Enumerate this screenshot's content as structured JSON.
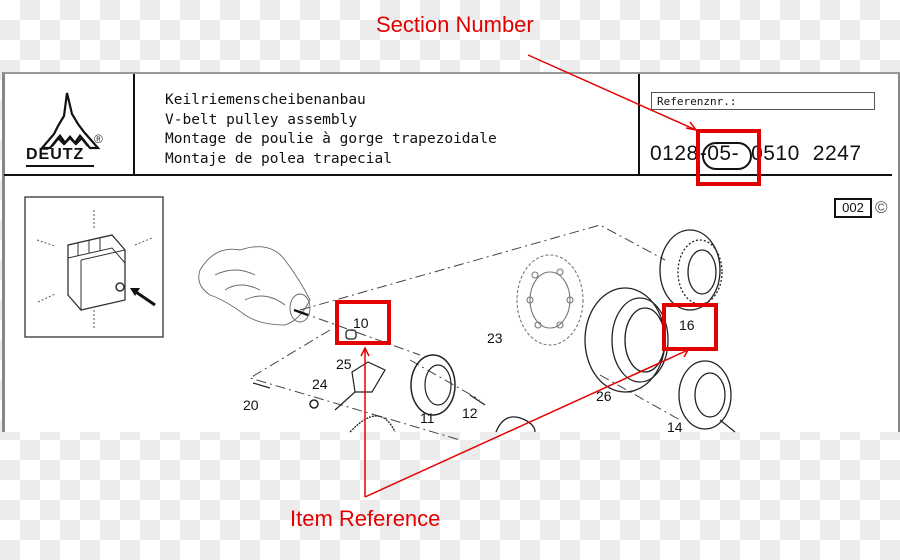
{
  "annotations": {
    "section_label": "Section Number",
    "item_label": "Item Reference",
    "accent_color": "#e30000"
  },
  "header": {
    "logo_text": "DEUTZ",
    "logo_mark": "®",
    "titles": [
      "Keilriemenscheibenanbau",
      "V-belt pulley assembly",
      "Montage de poulie à gorge trapezoidale",
      "Montaje de polea trapecial"
    ],
    "reference_label": "Referenznr.:",
    "reference_number": {
      "prefix": "0128",
      "section": "-05-",
      "part1": "0510",
      "part2": "2247"
    }
  },
  "page": {
    "number": "002",
    "copyright_symbol": "©"
  },
  "diagram": {
    "item_numbers": [
      "10",
      "25",
      "24",
      "20",
      "11",
      "12",
      "23",
      "26",
      "16",
      "14"
    ],
    "highlighted_items": [
      "10",
      "16"
    ]
  }
}
